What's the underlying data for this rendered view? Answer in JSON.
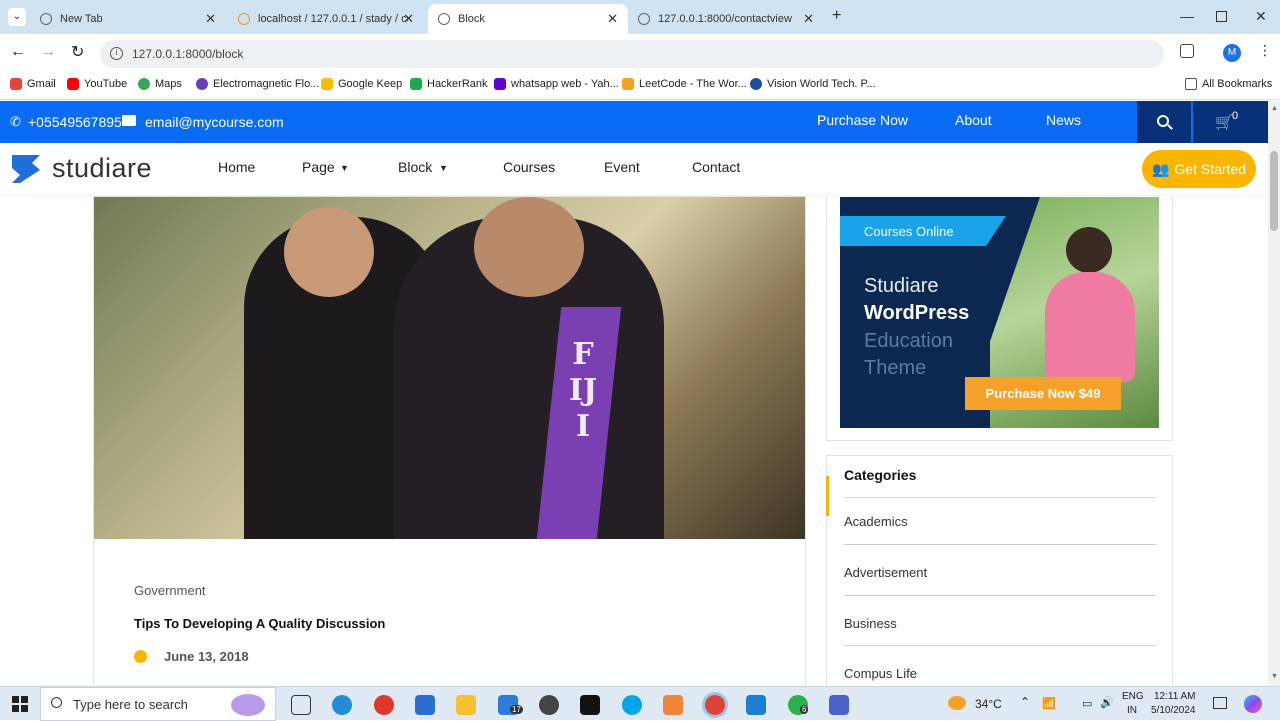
{
  "browser": {
    "tabs": [
      {
        "label": "New Tab",
        "active": false
      },
      {
        "label": "localhost / 127.0.0.1 / stady / co",
        "active": false
      },
      {
        "label": "Block",
        "active": true
      },
      {
        "label": "127.0.0.1:8000/contactview",
        "active": false
      }
    ],
    "url": "127.0.0.1:8000/block",
    "profile_initial": "M",
    "bookmarks": [
      {
        "label": "Gmail",
        "color": "#ea4335"
      },
      {
        "label": "YouTube",
        "color": "#ff0000"
      },
      {
        "label": "Maps",
        "color": "#34a853"
      },
      {
        "label": "Electromagnetic Flo...",
        "color": "#6a3fb5"
      },
      {
        "label": "Google Keep",
        "color": "#fbbc04"
      },
      {
        "label": "HackerRank",
        "color": "#1ba94c"
      },
      {
        "label": "whatsapp web - Yah...",
        "color": "#6001d2"
      },
      {
        "label": "LeetCode - The Wor...",
        "color": "#f89f1b"
      },
      {
        "label": "Vision World Tech. P...",
        "color": "#1a4fa0"
      }
    ],
    "all_bookmarks": "All Bookmarks"
  },
  "site": {
    "phone": "+05549567895",
    "email": "email@mycourse.com",
    "top_links": [
      "Purchase Now",
      "About",
      "News"
    ],
    "cart_count": "0",
    "logo": "studiare",
    "nav": [
      "Home",
      "Page",
      "Block",
      "Courses",
      "Event",
      "Contact"
    ],
    "cta": "Get Started",
    "colors": {
      "brand": "#0a6cf5",
      "accent": "#f9b500",
      "ad_bg": "#0c2850"
    }
  },
  "post": {
    "category": "Government",
    "title": "Tips To Developing A Quality Discussion",
    "date": "June 13, 2018",
    "photo_text": "FIJI"
  },
  "sidebar": {
    "ad": {
      "badge": "Courses Online",
      "line1": "Studiare",
      "line2": "WordPress",
      "line3": "Education",
      "line4": "Theme",
      "button": "Purchase Now $49"
    },
    "categories_title": "Categories",
    "categories": [
      "Academics",
      "Advertisement",
      "Business",
      "Compus Life"
    ]
  },
  "taskbar": {
    "search_placeholder": "Type here to search",
    "mail_badge": "17",
    "whatsapp_badge": "6",
    "weather": "34°C",
    "lang1": "ENG",
    "lang2": "IN",
    "time": "12:11 AM",
    "date": "5/10/2024"
  }
}
